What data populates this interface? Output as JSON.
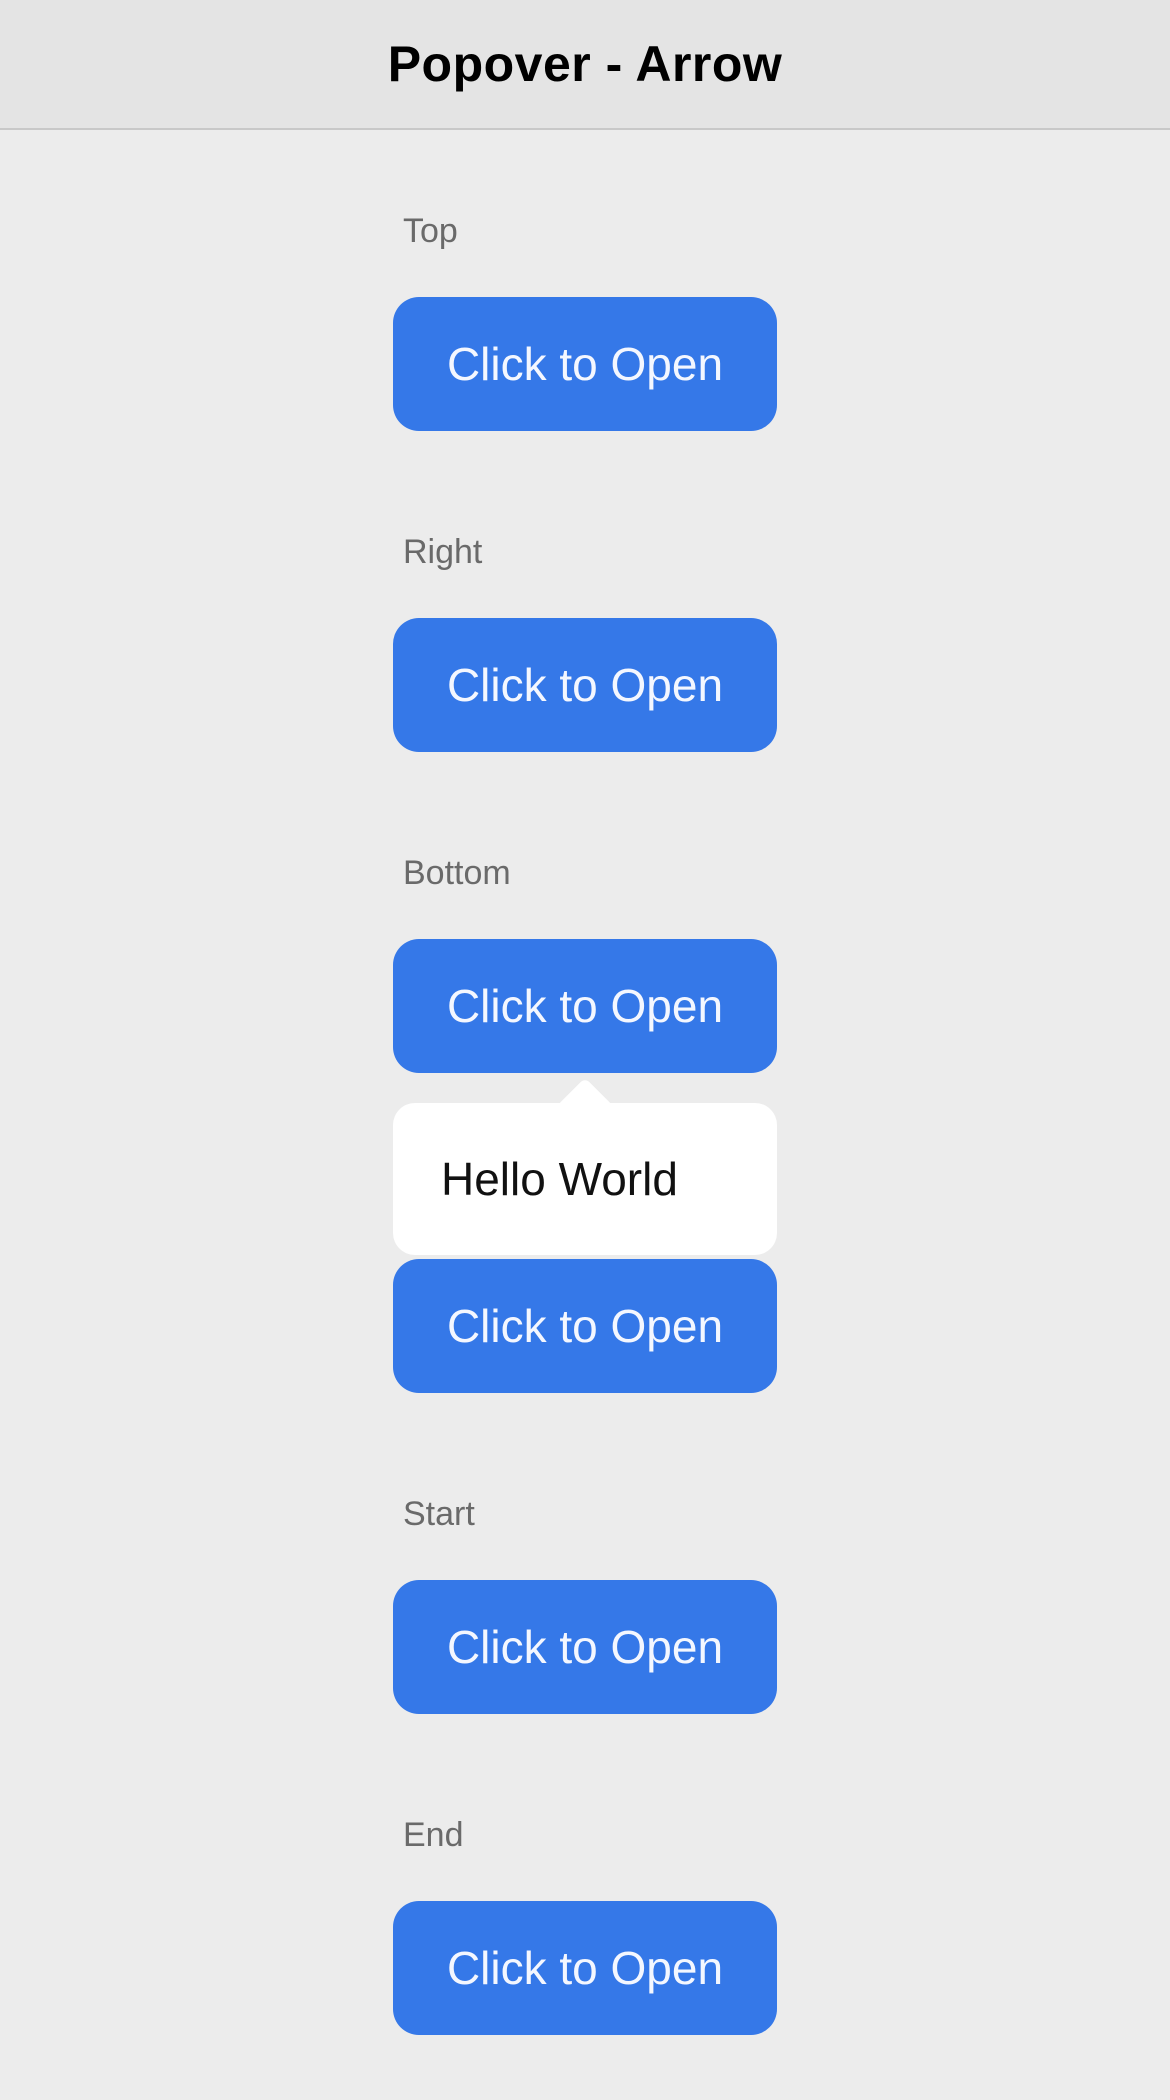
{
  "header": {
    "title": "Popover - Arrow"
  },
  "sections": [
    {
      "label": "Top",
      "button_label": "Click to Open"
    },
    {
      "label": "Right",
      "button_label": "Click to Open"
    },
    {
      "label": "Bottom",
      "button_label": "Click to Open"
    },
    {
      "label": "",
      "button_label": "Click to Open"
    },
    {
      "label": "Start",
      "button_label": "Click to Open"
    },
    {
      "label": "End",
      "button_label": "Click to Open"
    }
  ],
  "popover": {
    "text": "Hello World"
  },
  "colors": {
    "button_background": "#3578e8",
    "page_background": "#ececec",
    "toolbar_background": "#e4e4e4",
    "popover_background": "#ffffff"
  }
}
